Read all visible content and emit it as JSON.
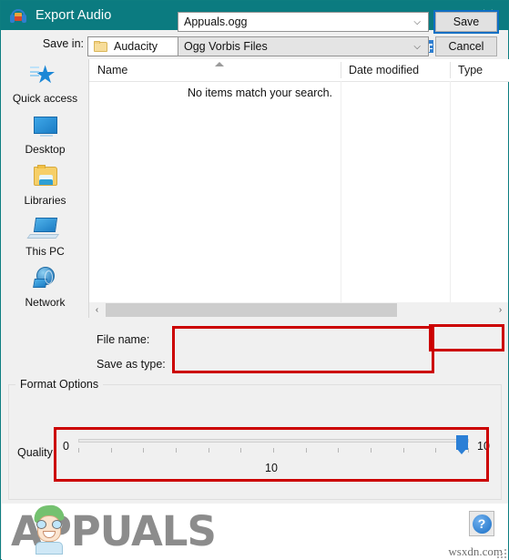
{
  "window": {
    "title": "Export Audio",
    "app_icon": "audacity-headphones-icon",
    "close_label": "✕",
    "titlebar_color": "#0b7b80"
  },
  "savein": {
    "label": "Save in:",
    "value": "Audacity",
    "arrow": "⌵"
  },
  "toolbar": {
    "back": "back-icon",
    "up": "up-one-level-icon",
    "new_folder": "new-folder-icon",
    "views": "change-view-icon",
    "views_caret": "▾"
  },
  "places": [
    {
      "label": "Quick access",
      "icon": "star-icon"
    },
    {
      "label": "Desktop",
      "icon": "monitor-icon"
    },
    {
      "label": "Libraries",
      "icon": "libraries-folder-icon"
    },
    {
      "label": "This PC",
      "icon": "computer-icon"
    },
    {
      "label": "Network",
      "icon": "network-globe-icon"
    }
  ],
  "filelist": {
    "columns": [
      "Name",
      "Date modified",
      "Type"
    ],
    "sort_indicator": "ascending",
    "empty_message": "No items match your search.",
    "rows": []
  },
  "scrollbar": {
    "left_arrow": "‹",
    "right_arrow": "›"
  },
  "form": {
    "filename_label": "File name:",
    "filename_value": "Appuals.ogg",
    "filename_placeholder": "",
    "savetype_label": "Save as type:",
    "savetype_value": "Ogg Vorbis Files",
    "combo_arrow": "⌵",
    "save_label": "Save",
    "cancel_label": "Cancel"
  },
  "format_options": {
    "legend": "Format Options",
    "quality_label": "Quality:",
    "slider_min": "0",
    "slider_max": "10",
    "slider_value": "10",
    "tick_count": 13
  },
  "annotations": {
    "color": "#cc0000",
    "boxes": [
      "filename-and-type-fields",
      "save-button",
      "quality-slider"
    ]
  },
  "watermark": {
    "logo_text": "APPUALS",
    "mascot": "appuals-mascot-icon",
    "site": "wsxdn.com",
    "help_glyph": "?"
  }
}
